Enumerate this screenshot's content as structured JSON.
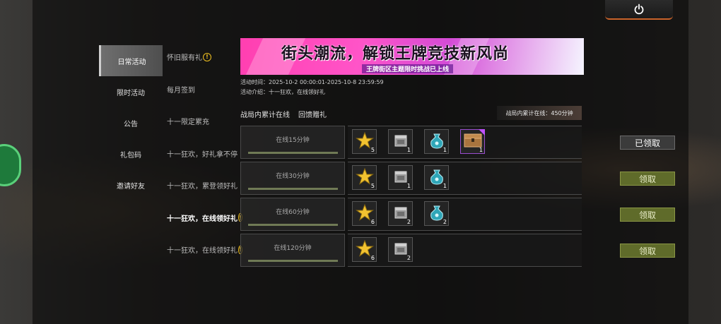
{
  "nav": [
    {
      "label": "日常活动",
      "active": true
    },
    {
      "label": "限时活动",
      "active": false
    },
    {
      "label": "公告",
      "active": false
    },
    {
      "label": "礼包码",
      "active": false
    },
    {
      "label": "邀请好友",
      "active": false
    }
  ],
  "sub": [
    {
      "label": "怀旧服有礼",
      "active": false,
      "warn": true
    },
    {
      "label": "每月签到",
      "active": false,
      "warn": false
    },
    {
      "label": "十一限定累充",
      "active": false,
      "warn": false
    },
    {
      "label": "十一狂欢，好礼拿不停",
      "active": false,
      "warn": false
    },
    {
      "label": "十一狂欢，累登领好礼",
      "active": false,
      "warn": false
    },
    {
      "label": "十一狂欢，在线领好礼",
      "active": true,
      "warn": true
    },
    {
      "label": "十一狂欢，在线领好礼",
      "active": false,
      "warn": true
    }
  ],
  "warn_glyph": "!",
  "banner": {
    "title": "街头潮流，解锁王牌竞技新风尚",
    "subtitle": "王牌街区主题限时挑战已上线"
  },
  "info": {
    "time": "活动时间：2025-10-2 00:00:01-2025-10-8 23:59:59",
    "desc": "活动介绍：十一狂欢，在线领好礼"
  },
  "header": {
    "left1": "战局内累计在线",
    "left2": "回馈赠礼",
    "total": "战局内累计在线：450分钟"
  },
  "rows": [
    {
      "label": "在线15分钟",
      "items": [
        {
          "icon": "star-icon",
          "qty": "5",
          "rare": false
        },
        {
          "icon": "metal-crate-icon",
          "qty": "1",
          "rare": false
        },
        {
          "icon": "bag-icon",
          "qty": "1",
          "rare": false
        },
        {
          "icon": "chest-icon",
          "qty": "1",
          "rare": true
        }
      ],
      "button": "已领取",
      "state": "claimed"
    },
    {
      "label": "在线30分钟",
      "items": [
        {
          "icon": "star-icon",
          "qty": "5",
          "rare": false
        },
        {
          "icon": "metal-crate-icon",
          "qty": "1",
          "rare": false
        },
        {
          "icon": "bag-icon",
          "qty": "1",
          "rare": false
        }
      ],
      "button": "领取",
      "state": "claim"
    },
    {
      "label": "在线60分钟",
      "items": [
        {
          "icon": "star-icon",
          "qty": "6",
          "rare": false
        },
        {
          "icon": "metal-crate-icon",
          "qty": "2",
          "rare": false
        },
        {
          "icon": "bag-icon",
          "qty": "2",
          "rare": false
        }
      ],
      "button": "领取",
      "state": "claim"
    },
    {
      "label": "在线120分钟",
      "items": [
        {
          "icon": "star-icon",
          "qty": "6",
          "rare": false
        },
        {
          "icon": "metal-crate-icon",
          "qty": "2",
          "rare": false
        }
      ],
      "button": "领取",
      "state": "claim"
    }
  ],
  "colors": {
    "accent": "#c9632a",
    "claim": "#5f6b2a",
    "star": "#f2c230",
    "bag": "#2fa6b8"
  }
}
